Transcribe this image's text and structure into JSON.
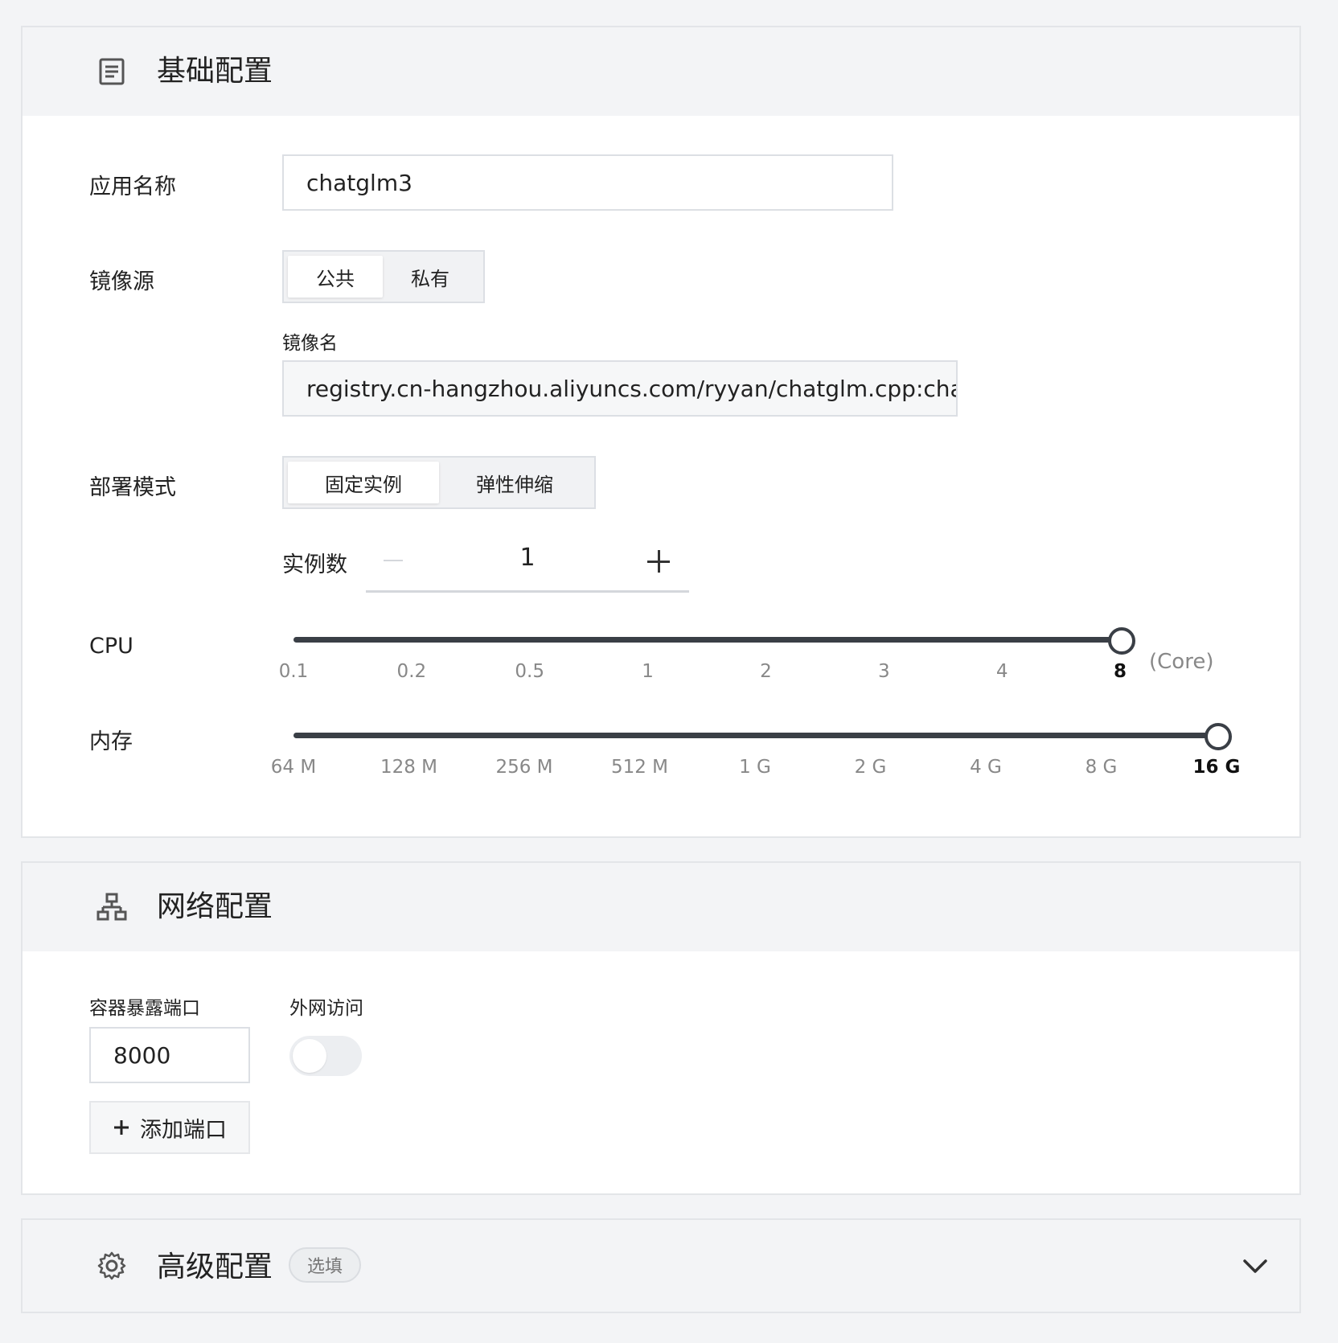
{
  "basic": {
    "title": "基础配置",
    "app_name_label": "应用名称",
    "app_name_value": "chatglm3",
    "image_source_label": "镜像源",
    "image_source_options": [
      "公共",
      "私有"
    ],
    "image_source_selected": "公共",
    "image_name_label": "镜像名",
    "image_name_value": "registry.cn-hangzhou.aliyuncs.com/ryyan/chatglm.cpp:chat",
    "deploy_mode_label": "部署模式",
    "deploy_mode_options": [
      "固定实例",
      "弹性伸缩"
    ],
    "deploy_mode_selected": "固定实例",
    "instance_count_label": "实例数",
    "instance_count_value": "1",
    "cpu_label": "CPU",
    "cpu_ticks": [
      "0.1",
      "0.2",
      "0.5",
      "1",
      "2",
      "3",
      "4",
      "8"
    ],
    "cpu_selected": "8",
    "cpu_unit": "(Core)",
    "memory_label": "内存",
    "memory_ticks": [
      "64 M",
      "128 M",
      "256 M",
      "512 M",
      "1 G",
      "2 G",
      "4 G",
      "8 G",
      "16 G"
    ],
    "memory_selected": "16 G"
  },
  "network": {
    "title": "网络配置",
    "port_label": "容器暴露端口",
    "port_value": "8000",
    "public_access_label": "外网访问",
    "public_access_enabled": false,
    "add_port_label": "添加端口"
  },
  "advanced": {
    "title": "高级配置",
    "badge": "选填",
    "expanded": false
  }
}
